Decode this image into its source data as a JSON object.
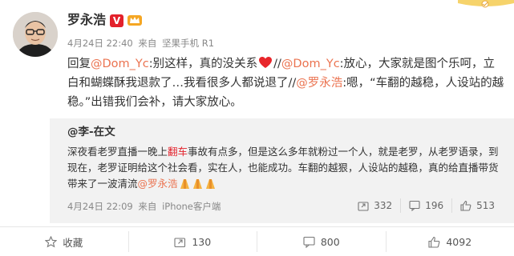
{
  "post": {
    "author": "罗永浩",
    "verified_badge": "V",
    "time": "4月24日 22:40",
    "source_prefix": "来自",
    "source": "坚果手机 R1",
    "content": {
      "t1": "回复",
      "at_dom1": "@Dom_Yc",
      "t2": ":别这样，真的没关系",
      "t3": "//",
      "at_dom2": "@Dom_Yc",
      "t4": ":放心，大家就是图个乐呵，立白和蝴蝶酥我退款了…我看很多人都说退了//",
      "at_luo": "@罗永浩",
      "t5": ":嗯，“车翻的越稳，人设站的越稳。”出错我们会补，请大家放心。"
    }
  },
  "repost": {
    "author": "@李-在文",
    "text": {
      "t1": "深夜看老罗直播一晚上",
      "highlight": "翻车",
      "t2": "事故有点多，但是这么多年就粉过一个人，就是老罗，从老罗语录，到现在，老罗证明给这个社会看，实在人，也能成功。车翻的越狠，人设站的越稳，真的给直播带货带来了一波清流",
      "at_luo": "@罗永浩"
    },
    "time": "4月24日 22:09",
    "source_prefix": "来自",
    "source": "iPhone客户端",
    "share_count": "332",
    "comment_count": "196",
    "like_count": "513"
  },
  "actions": {
    "favorite_label": "收藏",
    "share_count": "130",
    "comment_count": "800",
    "like_count": "4092"
  },
  "colors": {
    "mention": "#eb7350",
    "highlight": "#e3212b",
    "repost_bg": "#f2f2f2"
  }
}
